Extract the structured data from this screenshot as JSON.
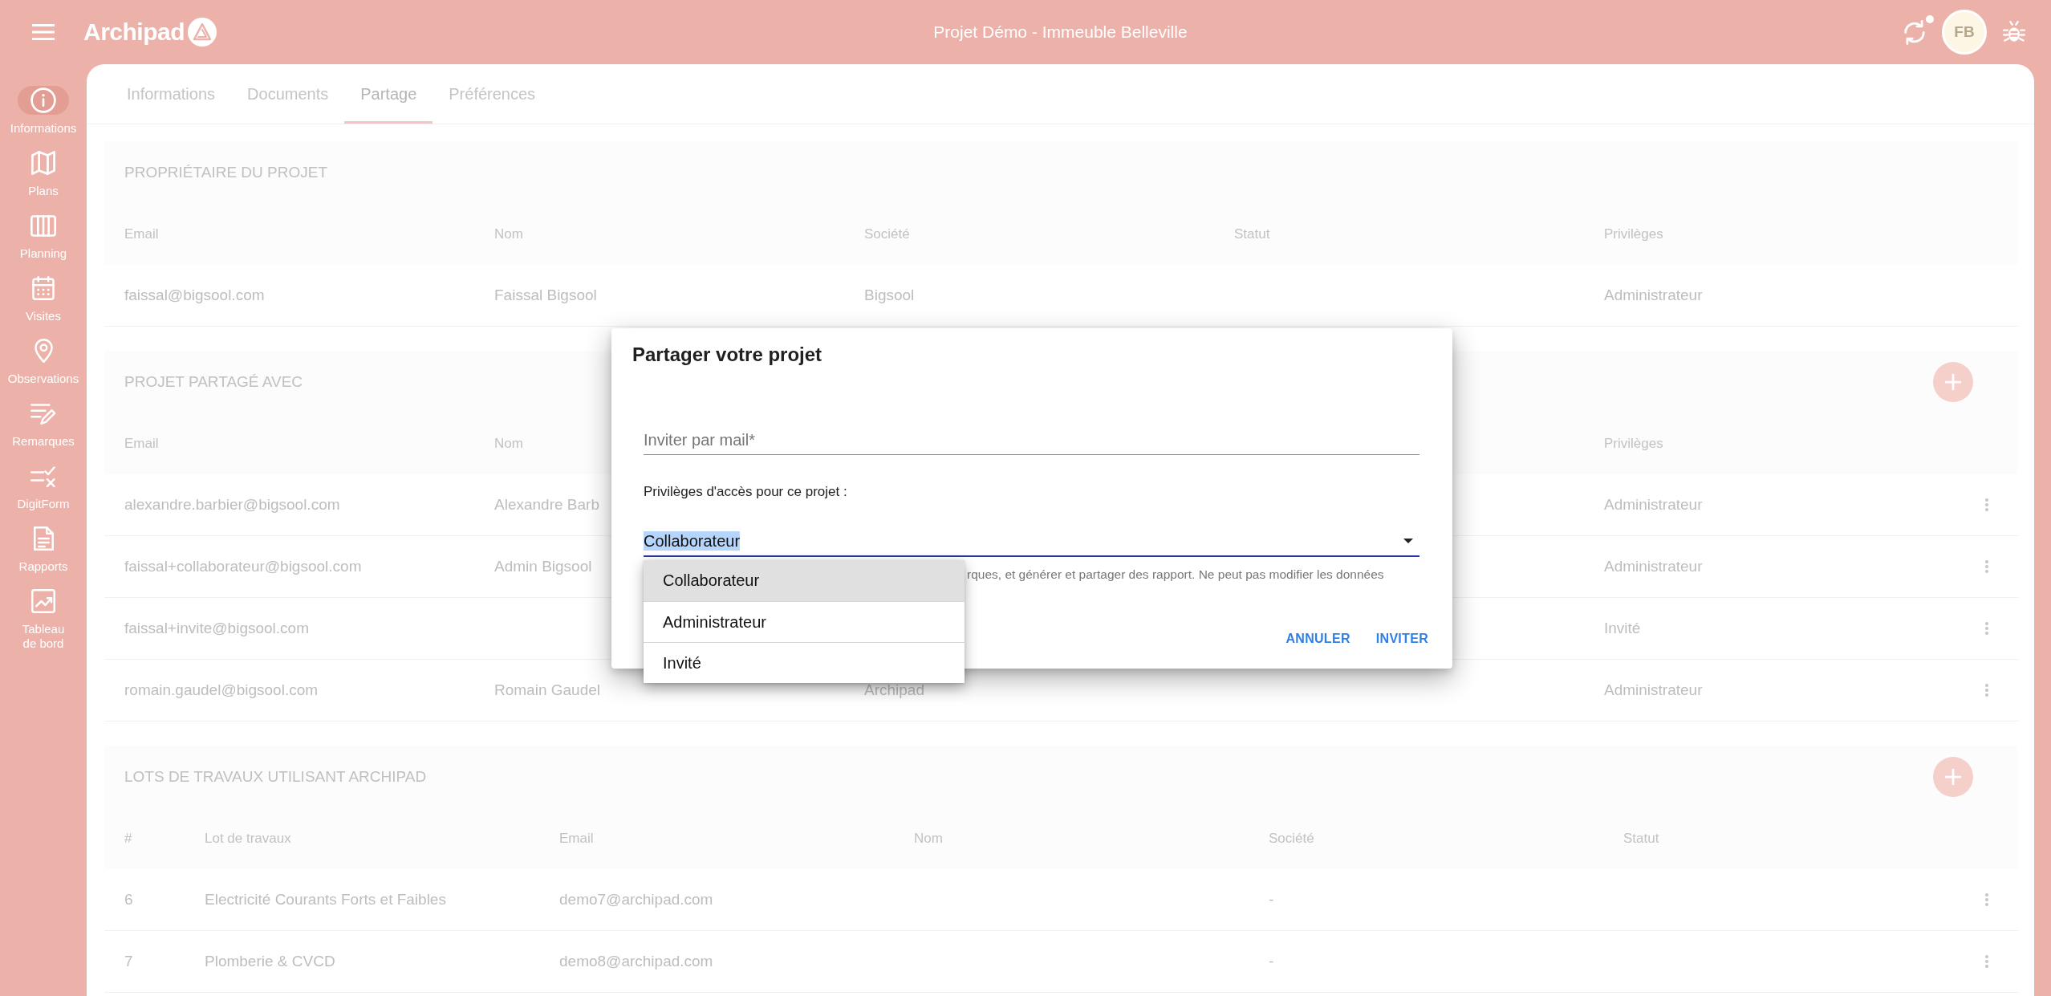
{
  "app_bar": {
    "logo": "Archipad",
    "title": "Projet Démo - Immeuble Belleville",
    "sync_badge": true,
    "avatar": "FB"
  },
  "sidebar": {
    "items": [
      {
        "label": "Informations",
        "selected": true
      },
      {
        "label": "Plans",
        "selected": false
      },
      {
        "label": "Planning",
        "selected": false
      },
      {
        "label": "Visites",
        "selected": false
      },
      {
        "label": "Observations",
        "selected": false
      },
      {
        "label": "Remarques",
        "selected": false
      },
      {
        "label": "DigitForm",
        "selected": false
      },
      {
        "label": "Rapports",
        "selected": false
      },
      {
        "label": "Tableau de bord",
        "selected": false
      }
    ]
  },
  "tabs": [
    {
      "label": "Informations",
      "selected": false
    },
    {
      "label": "Documents",
      "selected": false
    },
    {
      "label": "Partage",
      "selected": true
    },
    {
      "label": "Préférences",
      "selected": false
    }
  ],
  "sections": [
    {
      "title": "PROPRIÉTAIRE DU PROJET",
      "add_button": false,
      "columns": [
        "Email",
        "Nom",
        "Société",
        "Statut",
        "Privilèges"
      ],
      "rows": [
        {
          "cells": [
            "faissal@bigsool.com",
            "Faissal Bigsool",
            "Bigsool",
            null,
            "Administrateur"
          ],
          "menu": false
        }
      ]
    },
    {
      "title": "PROJET PARTAGÉ AVEC",
      "add_button": true,
      "columns": [
        "Email",
        "Nom",
        null,
        null,
        "Privilèges"
      ],
      "rows": [
        {
          "cells": [
            "alexandre.barbier@bigsool.com",
            "Alexandre Barb",
            null,
            null,
            "Administrateur"
          ],
          "menu": true
        },
        {
          "cells": [
            "faissal+collaborateur@bigsool.com",
            "Admin Bigsool",
            null,
            null,
            "Administrateur"
          ],
          "menu": true
        },
        {
          "cells": [
            "faissal+invite@bigsool.com",
            null,
            null,
            null,
            "Invité"
          ],
          "menu": true
        },
        {
          "cells": [
            "romain.gaudel@bigsool.com",
            "Romain Gaudel",
            "Archipad",
            null,
            "Administrateur"
          ],
          "menu": true
        }
      ]
    },
    {
      "title": "LOTS DE TRAVAUX UTILISANT ARCHIPAD",
      "add_button": true,
      "columns": [
        "#",
        "Lot de travaux",
        "Email",
        "Nom",
        "Société",
        "Statut"
      ],
      "rows": [
        {
          "cells": [
            "6",
            "Electricité Courants Forts et Faibles",
            "demo7@archipad.com",
            null,
            "-",
            null
          ],
          "menu": true
        },
        {
          "cells": [
            "7",
            "Plomberie & CVCD",
            "demo8@archipad.com",
            null,
            "-",
            null
          ],
          "menu": true
        }
      ]
    }
  ],
  "dialog": {
    "title": "Partager votre projet",
    "email_field": {
      "placeholder": "Inviter par mail*"
    },
    "privileges_label": "Privilèges d'accès pour ce projet :",
    "privileges_select": {
      "value": "Collaborateur",
      "value_highlighted": true,
      "expanded": true,
      "helper": "rques, et générer et partager des rapport. Ne peut pas modifier les données",
      "options": [
        {
          "label": "Collaborateur",
          "selected": true
        },
        {
          "label": "Administrateur",
          "selected": false
        },
        {
          "label": "Invité",
          "selected": false
        }
      ]
    },
    "buttons": [
      "ANNULER",
      "INVITER"
    ]
  }
}
